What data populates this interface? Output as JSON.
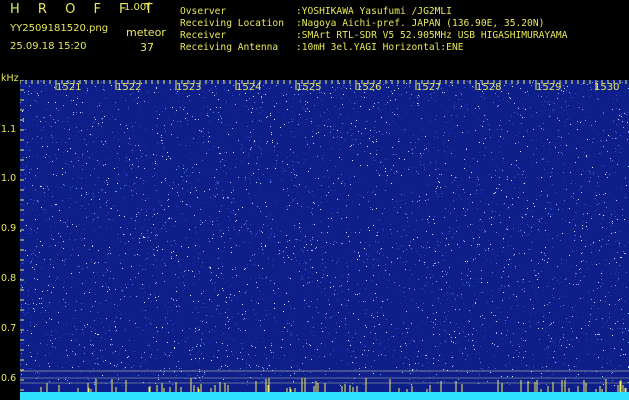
{
  "header": {
    "app_title": "H R O F F T",
    "version": "1.00f",
    "filename": "YY2509181520.png",
    "datetime": "25.09.18 15:20",
    "meteor_label": "meteor",
    "meteor_count": "37",
    "info": [
      {
        "key": "Ovserver",
        "value": ":YOSHIKAWA Yasufumi /JG2MLI"
      },
      {
        "key": "Receiving Location",
        "value": ":Nagoya Aichi-pref. JAPAN (136.90E, 35.20N)"
      },
      {
        "key": "Receiver",
        "value": ":SMArt RTL-SDR V5 52.905MHz USB HIGASHIMURAYAMA"
      },
      {
        "key": "Receiving Antenna",
        "value": ":10mH 3el.YAGI Horizontal:ENE"
      }
    ]
  },
  "axes": {
    "y_unit": "kHz",
    "y_ticks": [
      "1.1",
      "1.0",
      "0.9",
      "0.8",
      "0.7",
      "0.6"
    ],
    "x_ticks": [
      "1521",
      "1522",
      "1523",
      "1524",
      "1525",
      "1526",
      "1527",
      "1528",
      "1529",
      "1530"
    ]
  },
  "colors": {
    "background": "#000000",
    "label": "#e8e85a",
    "spectrogram_base": "#0f1f8a",
    "noise_bright": "#8fd0ff",
    "baseline_cyan": "#30e0ff"
  }
}
